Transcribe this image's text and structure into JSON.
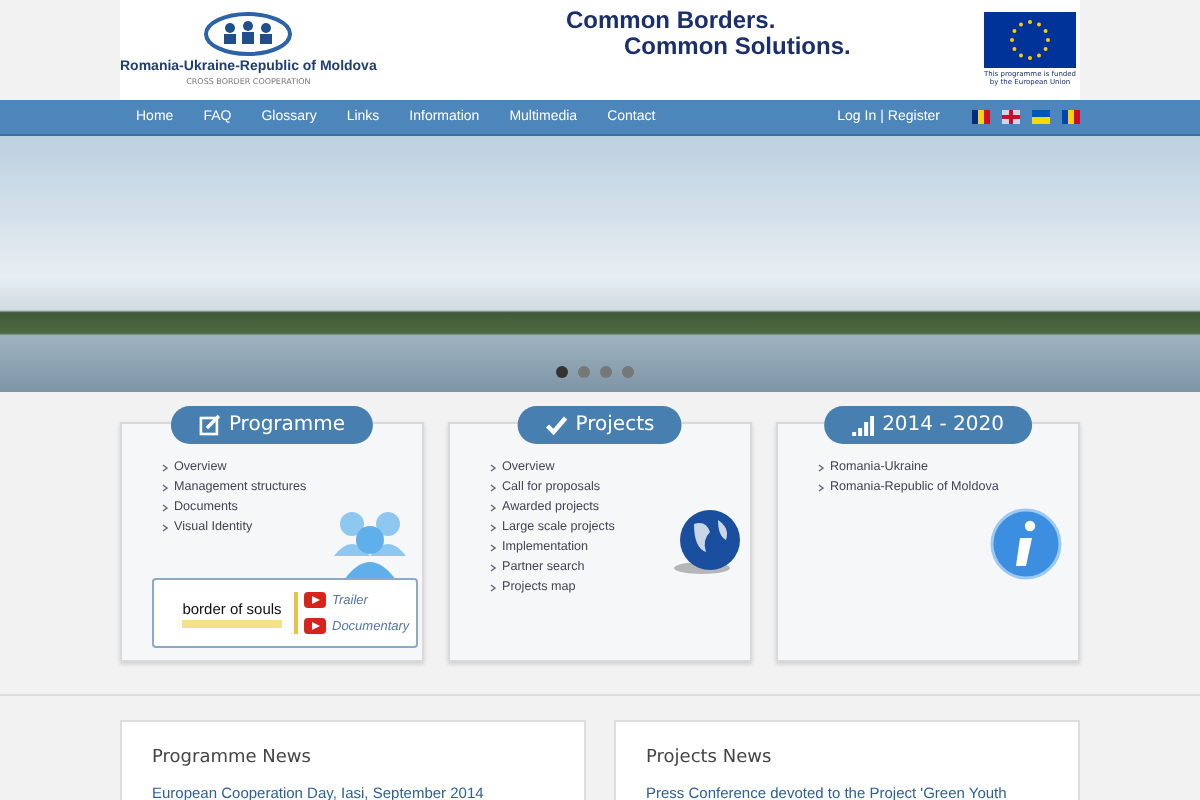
{
  "header": {
    "logo_title": "Romania-Ukraine-Republic of Moldova",
    "logo_subtitle": "CROSS BORDER COOPERATION",
    "slogan_line_1": "Common Borders.",
    "slogan_line_2": "Common Solutions.",
    "eu_caption": "This programme is funded by the European Union"
  },
  "nav": {
    "items": [
      "Home",
      "FAQ",
      "Glossary",
      "Links",
      "Information",
      "Multimedia",
      "Contact"
    ],
    "login": "Log In",
    "separator": "|",
    "register": "Register",
    "flags": [
      {
        "kind": "ro"
      },
      {
        "kind": "uk"
      },
      {
        "kind": "ua"
      },
      {
        "kind": "md"
      }
    ]
  },
  "carousel": {
    "dots": [
      {
        "selected": true
      },
      {
        "selected": false
      },
      {
        "selected": false
      },
      {
        "selected": false
      }
    ]
  },
  "panels": [
    {
      "kind": "programme",
      "title": "Programme",
      "links": [
        "Overview",
        "Management structures",
        "Documents",
        "Visual Identity"
      ],
      "video_box": {
        "brand": "border of souls",
        "links": [
          "Trailer",
          "Documentary"
        ]
      }
    },
    {
      "kind": "projects",
      "title": "Projects",
      "links": [
        "Overview",
        "Call for proposals",
        "Awarded projects",
        "Large scale projects",
        "Implementation",
        "Partner search",
        "Projects map"
      ]
    },
    {
      "kind": "period",
      "title": "2014 - 2020",
      "links": [
        "Romania-Ukraine",
        "Romania-Republic of Moldova"
      ]
    }
  ],
  "news": [
    {
      "title": "Programme News",
      "first_item": "European Cooperation Day, Iasi, September 2014"
    },
    {
      "title": "Projects News",
      "first_item": "Press Conference devoted to the Project 'Green Youth"
    }
  ]
}
